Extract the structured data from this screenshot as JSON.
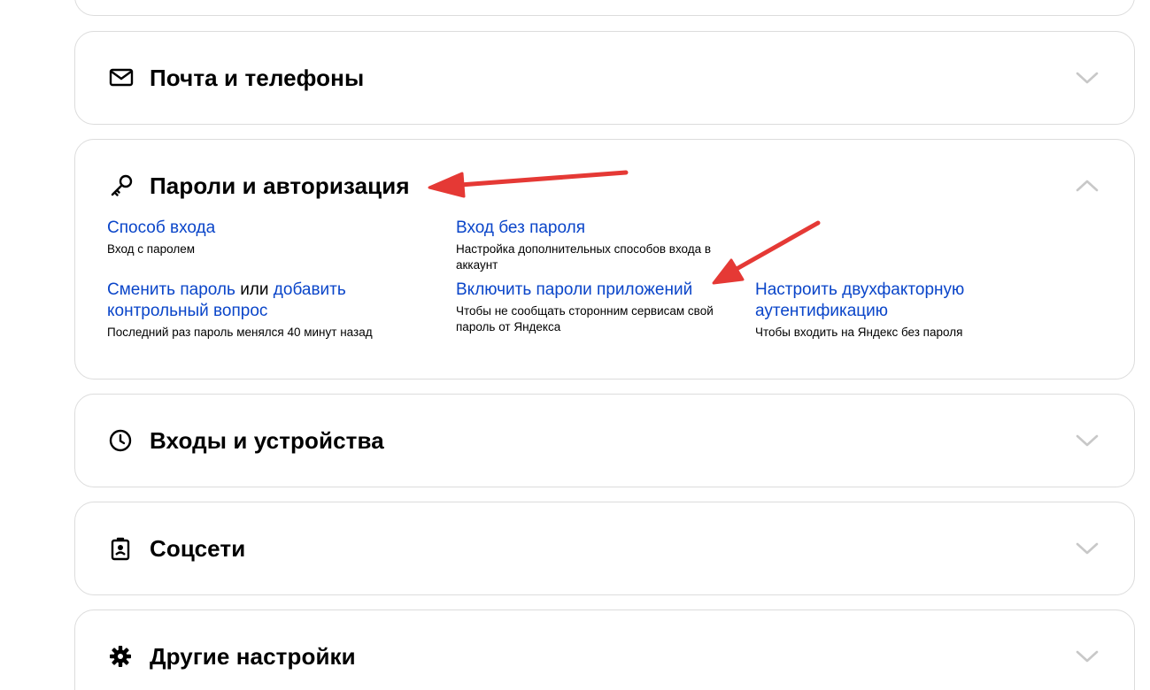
{
  "sections": {
    "mail": {
      "title": "Почта и телефоны"
    },
    "passwords": {
      "title": "Пароли и авторизация",
      "items": {
        "login_method": {
          "link": "Способ входа",
          "desc": "Вход с паролем"
        },
        "passwordless": {
          "link": "Вход без пароля",
          "desc": "Настройка дополнительных способов входа в аккаунт"
        },
        "change_password": {
          "link1": "Сменить пароль",
          "connector": "или",
          "link2": "добавить контрольный вопрос",
          "desc": "Последний раз пароль менялся 40 минут назад"
        },
        "app_passwords": {
          "link": "Включить пароли приложений",
          "desc": "Чтобы не сообщать сторонним сервисам свой пароль от Яндекса"
        },
        "two_factor": {
          "link": "Настроить двухфакторную аутентификацию",
          "desc": "Чтобы входить на Яндекс без пароля"
        }
      }
    },
    "logins": {
      "title": "Входы и устройства"
    },
    "social": {
      "title": "Соцсети"
    },
    "other": {
      "title": "Другие настройки"
    }
  },
  "icons": {
    "mail": "envelope-icon",
    "passwords": "key-icon",
    "logins": "clock-icon",
    "social": "badge-icon",
    "other": "gear-icon",
    "collapsed": "chevron-down-icon",
    "expanded": "chevron-up-icon"
  },
  "colors": {
    "link": "#0a45c9",
    "annotation_arrow": "#e53935",
    "card_border": "#dcdcdc"
  }
}
